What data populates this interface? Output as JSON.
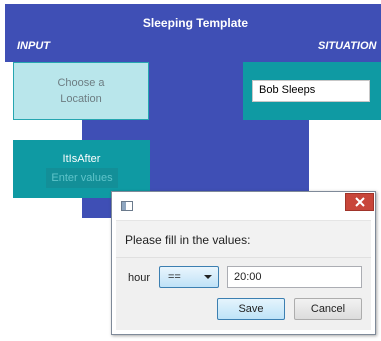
{
  "template": {
    "title": "Sleeping Template",
    "input_label": "INPUT",
    "situation_label": "SITUATION"
  },
  "location_box": {
    "line1": "Choose a",
    "line2": "Location"
  },
  "situation_box": {
    "value": "Bob Sleeps"
  },
  "after_box": {
    "title": "ItIsAfter",
    "placeholder": "Enter values"
  },
  "dialog": {
    "header": "Please fill in the values:",
    "field_label": "hour",
    "operator": "==",
    "value": "20:00",
    "save_label": "Save",
    "cancel_label": "Cancel"
  },
  "colors": {
    "panel_blue": "#3f4fb5",
    "teal": "#0f9aa3",
    "light_teal": "#b9e6eb",
    "close_red": "#c8463a"
  }
}
